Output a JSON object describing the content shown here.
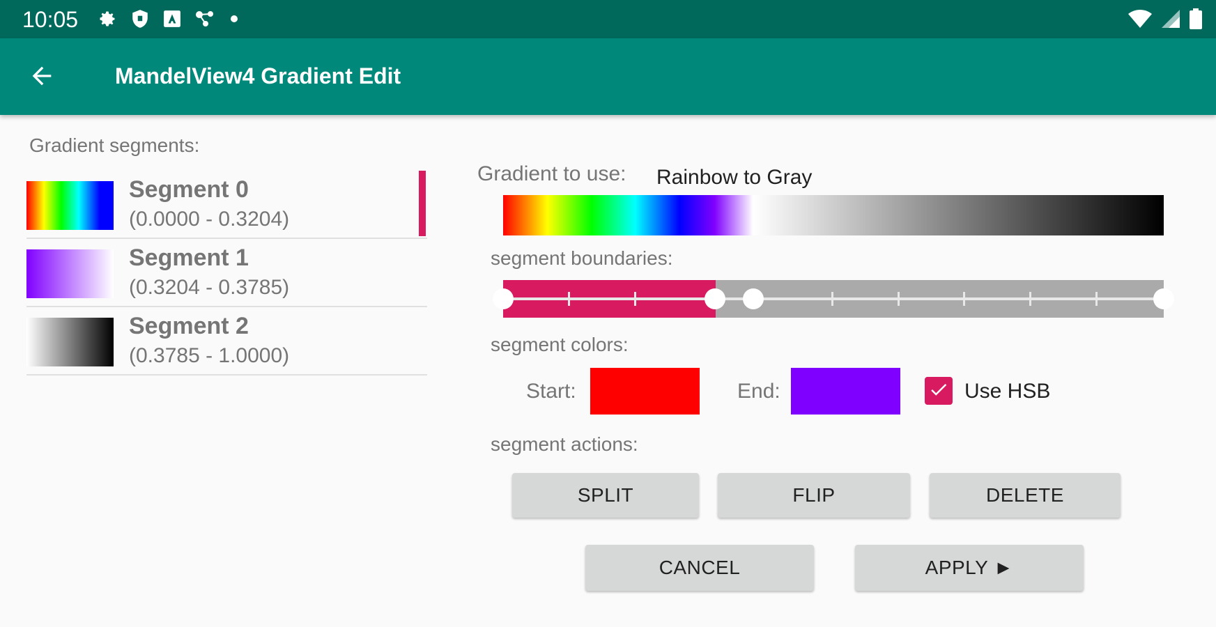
{
  "status_bar": {
    "time": "10:05",
    "left_icons": [
      "gear-icon",
      "shield-icon",
      "a-icon",
      "network-icon",
      "dot-icon"
    ],
    "right_icons": [
      "wifi-icon",
      "signal-icon",
      "battery-icon"
    ]
  },
  "app_bar": {
    "title": "MandelView4 Gradient Edit",
    "back_icon": "arrow-back-icon",
    "background": "#00897b"
  },
  "segments_panel": {
    "heading": "Gradient segments:",
    "items": [
      {
        "name": "Segment 0",
        "range": "(0.0000 - 0.3204)",
        "selected": true
      },
      {
        "name": "Segment 1",
        "range": "(0.3204 - 0.3785)",
        "selected": false
      },
      {
        "name": "Segment 2",
        "range": "(0.3785 - 1.0000)",
        "selected": false
      }
    ]
  },
  "gradient": {
    "label": "Gradient to use:",
    "value": "Rainbow to Gray"
  },
  "boundaries": {
    "label": "segment boundaries:",
    "boundary_values": [
      0.0,
      0.3204,
      0.3785,
      1.0
    ],
    "selected_segment": 0,
    "accent": "#d81b60"
  },
  "colors": {
    "label": "segment colors:",
    "start_label": "Start:",
    "start_color": "#ff0000",
    "end_label": "End:",
    "end_color": "#8000ff",
    "hsb_label": "Use HSB",
    "hsb_checked": true
  },
  "actions": {
    "label": "segment actions:",
    "split": "SPLIT",
    "flip": "FLIP",
    "delete": "DELETE"
  },
  "footer": {
    "cancel": "CANCEL",
    "apply": "APPLY ►"
  }
}
